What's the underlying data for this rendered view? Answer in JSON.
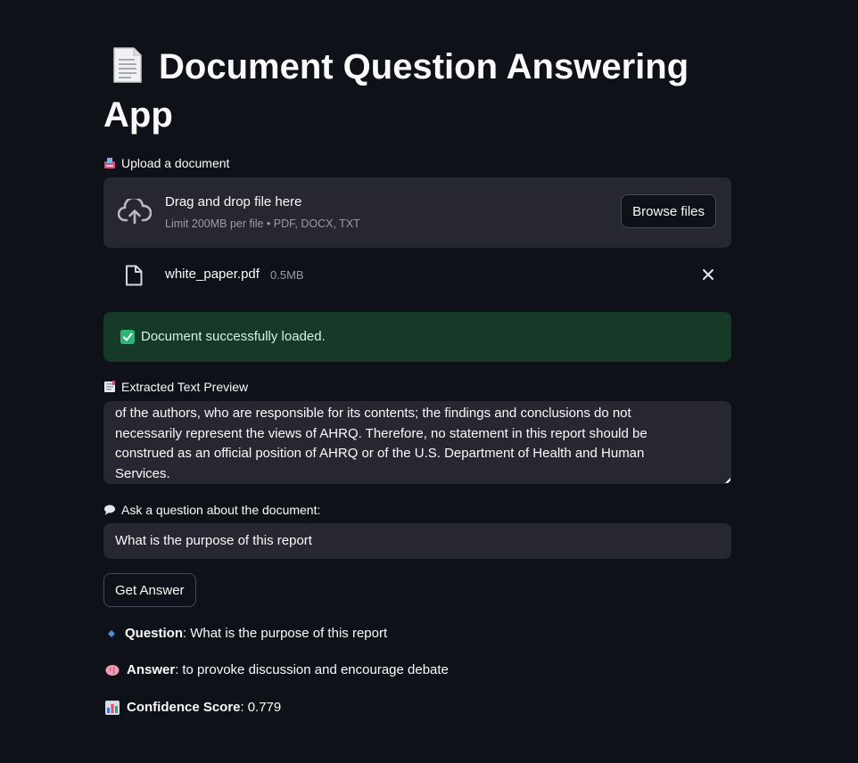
{
  "header": {
    "title": "Document Question Answering App",
    "emoji_icon": "page-facing-up-icon"
  },
  "upload": {
    "label": "Upload a document",
    "dropzone_title": "Drag and drop file here",
    "dropzone_hint": "Limit 200MB per file • PDF, DOCX, TXT",
    "browse_label": "Browse files",
    "file": {
      "name": "white_paper.pdf",
      "size": "0.5MB"
    }
  },
  "status": {
    "message": "Document successfully loaded."
  },
  "preview": {
    "label": "Extracted Text Preview",
    "text": "of the authors, who are responsible for its contents; the findings and conclusions do not\nnecessarily represent the views of AHRQ. Therefore, no statement in this report should be\nconstrued as an official position of AHRQ or of the U.S. Department of Health and Human\nServices."
  },
  "question": {
    "label": "Ask a question about the document:",
    "value": "What is the purpose of this report",
    "button_label": "Get Answer"
  },
  "results": {
    "question_label": "Question",
    "question_value": "What is the purpose of this report",
    "answer_label": "Answer",
    "answer_value": "to provoke discussion and encourage debate",
    "confidence_label": "Confidence Score",
    "confidence_value": "0.779"
  },
  "colors": {
    "background": "#0e1117",
    "surface": "#262730",
    "success_bg": "#173928",
    "text": "#fafafa",
    "muted": "#9a9ca6"
  }
}
